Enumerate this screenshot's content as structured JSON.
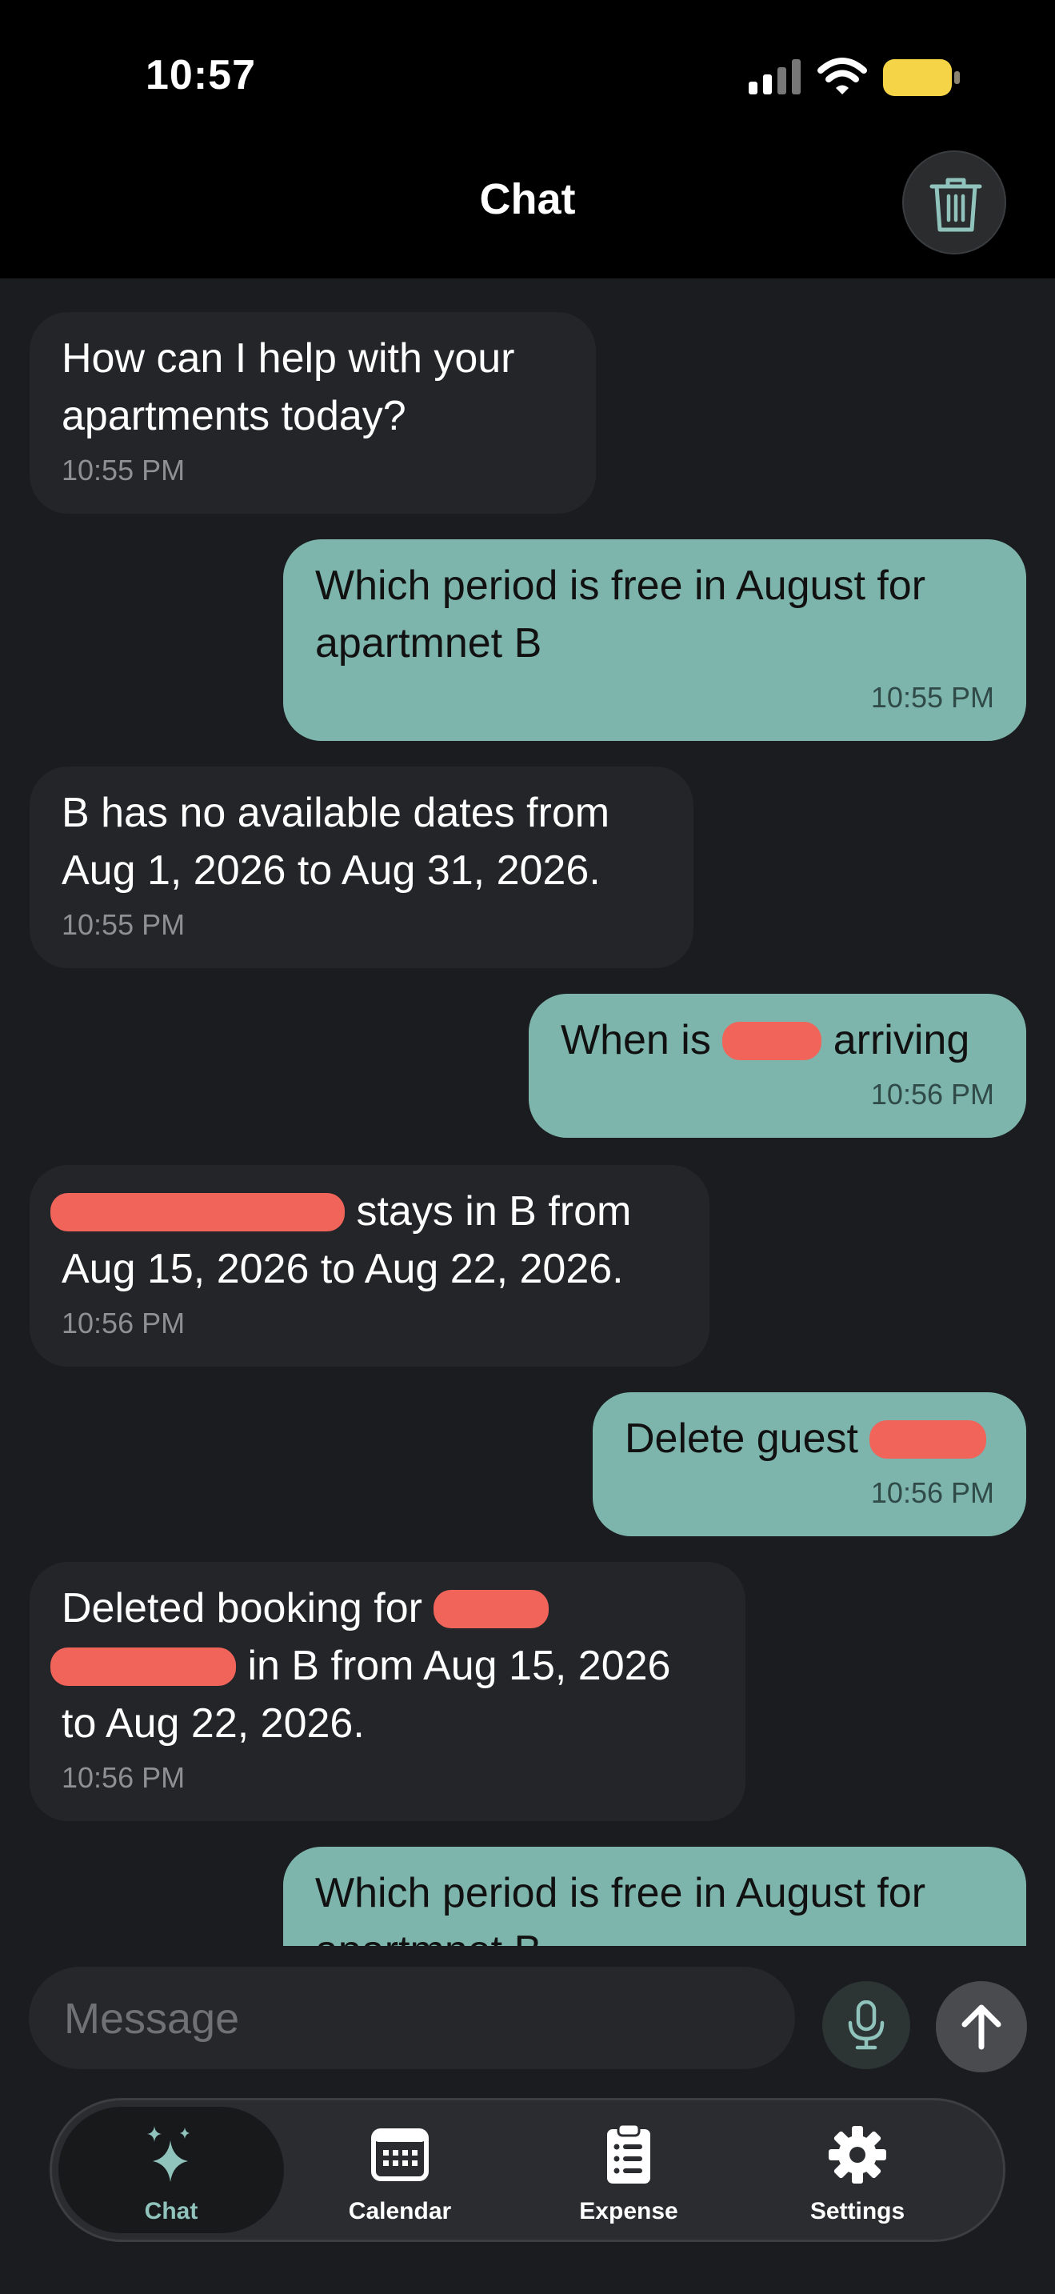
{
  "status_bar": {
    "time": "10:57"
  },
  "header": {
    "title": "Chat",
    "clear_icon": "trash-icon"
  },
  "messages": [
    {
      "sender": "assistant",
      "text": "How can I help with your\napartments today?",
      "time": "10:55 PM"
    },
    {
      "sender": "user",
      "text": "Which period is free in August for\napartmnet B",
      "time": "10:55 PM"
    },
    {
      "sender": "assistant",
      "text": "B has no available dates from\nAug 1, 2026 to Aug 31, 2026.",
      "time": "10:55 PM"
    },
    {
      "sender": "user",
      "text_before": "When is ",
      "text_after": " arriving",
      "time": "10:56 PM"
    },
    {
      "sender": "assistant",
      "text_after": " stays in B from",
      "line2": "Aug 15, 2026 to Aug 22, 2026.",
      "time": "10:56 PM"
    },
    {
      "sender": "user",
      "text_before": "Delete guest ",
      "time": "10:56 PM"
    },
    {
      "sender": "assistant",
      "text_before": "Deleted booking for ",
      "line2_after": " in B from Aug 15, 2026",
      "line3": "to Aug 22, 2026.",
      "time": "10:56 PM"
    },
    {
      "sender": "user",
      "text": "Which period is free in August for\napartmnet B"
    }
  ],
  "composer": {
    "placeholder": "Message",
    "mic_icon": "microphone-icon",
    "send_icon": "arrow-up-icon"
  },
  "tabs": [
    {
      "label": "Chat",
      "icon": "sparkles-icon",
      "active": true
    },
    {
      "label": "Calendar",
      "icon": "calendar-icon",
      "active": false
    },
    {
      "label": "Expense",
      "icon": "clipboard-icon",
      "active": false
    },
    {
      "label": "Settings",
      "icon": "gear-icon",
      "active": false
    }
  ],
  "colors": {
    "accent": "#7db5ad",
    "background": "#1b1c1f",
    "assistant_bubble": "#242529",
    "redaction": "#f0645a",
    "battery": "#f5d547"
  }
}
